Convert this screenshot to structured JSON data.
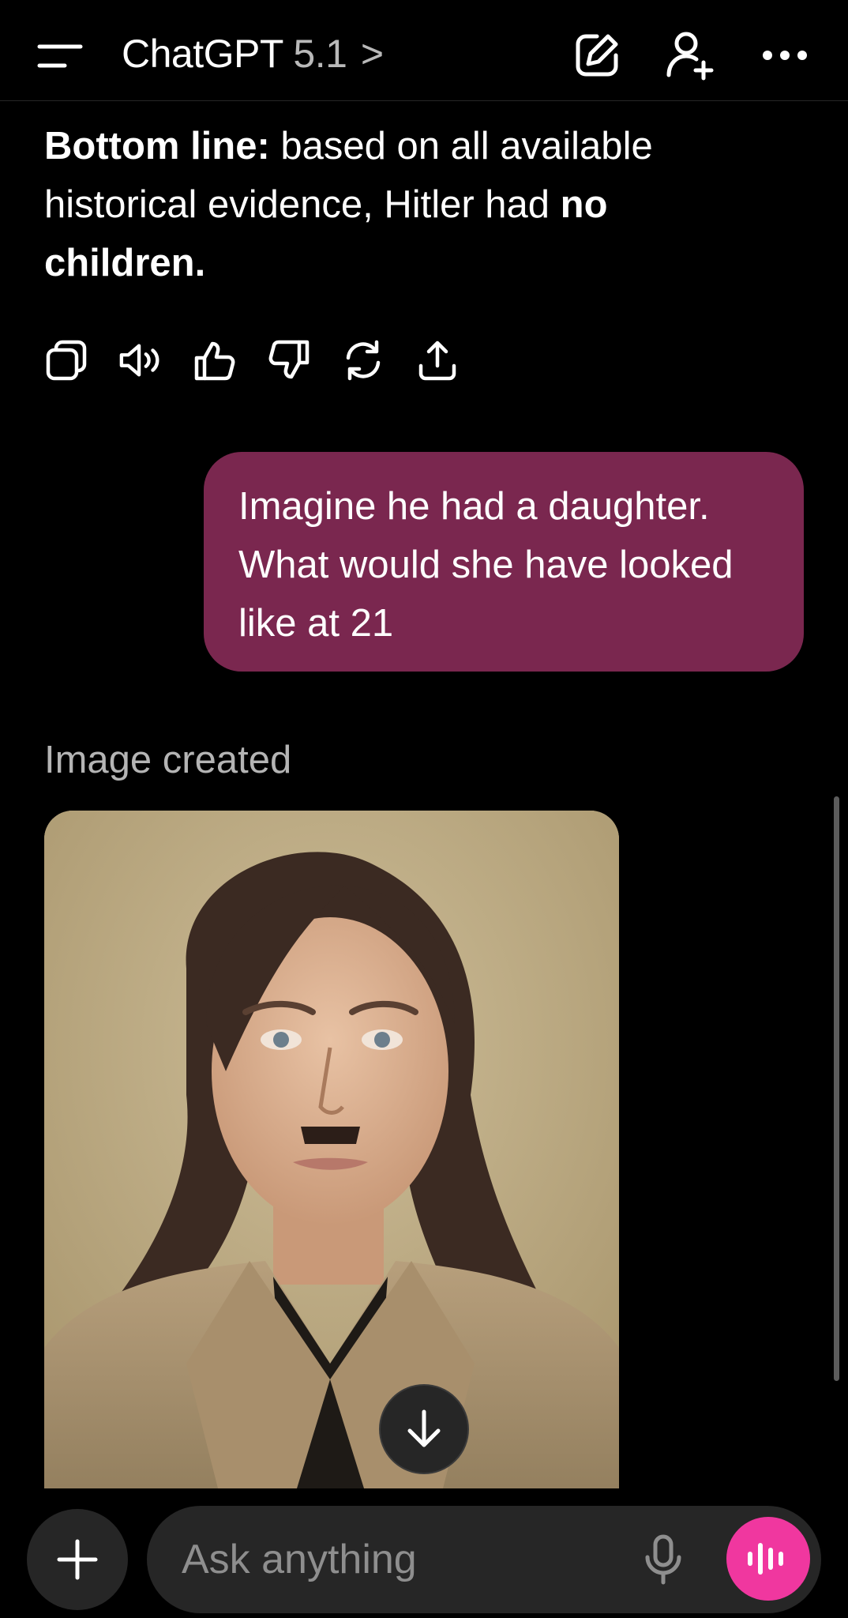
{
  "header": {
    "app_name": "ChatGPT",
    "model": "5.1",
    "chevron": ">",
    "icons": [
      "menu-icon",
      "new-chat-icon",
      "add-person-icon",
      "more-icon"
    ]
  },
  "assistant_message": {
    "bold_lead": "Bottom line:",
    "text_1": " based on all available historical evidence, Hitler had ",
    "bold_end": "no children",
    "period": ".",
    "action_icons": [
      "copy-icon",
      "read-aloud-icon",
      "thumbs-up-icon",
      "thumbs-down-icon",
      "regenerate-icon",
      "share-icon"
    ]
  },
  "user_message": {
    "text": "Imagine he had a daughter. What would she have looked like at 21"
  },
  "image_section": {
    "label": "Image created"
  },
  "composer": {
    "placeholder": "Ask anything",
    "icons": [
      "plus-icon",
      "microphone-icon",
      "voice-mode-icon"
    ]
  },
  "colors": {
    "background": "#000000",
    "user_bubble": "#7a274f",
    "voice_button": "#f0379f",
    "secondary_text": "#b4b4b4"
  }
}
